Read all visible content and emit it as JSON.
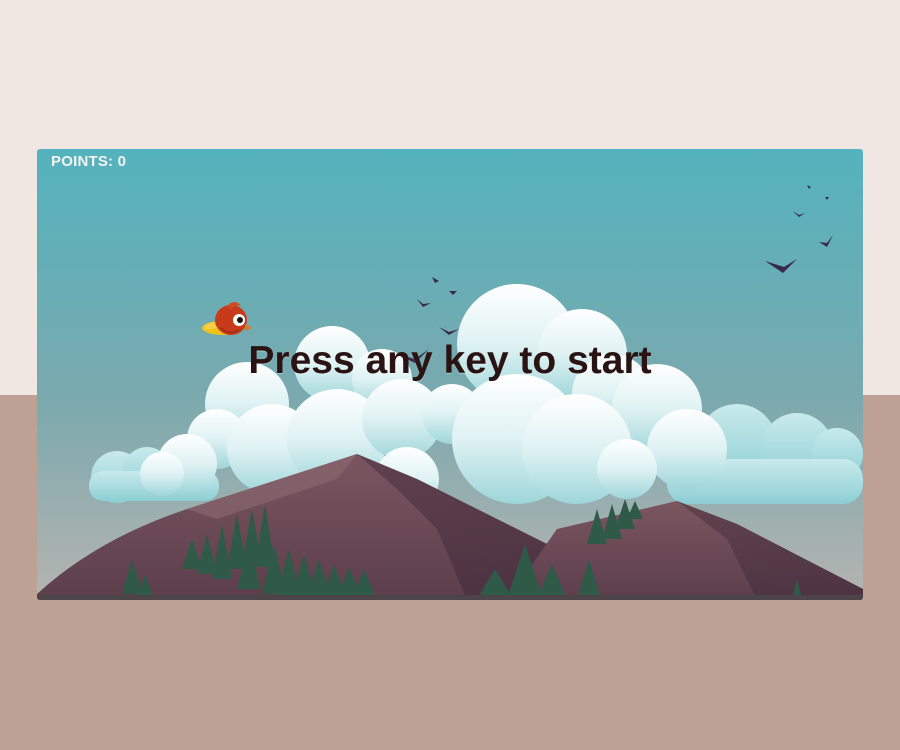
{
  "colors": {
    "page_top": "#f0e6e2",
    "page_bottom": "#bda195",
    "sky_top": "#54b3be",
    "sky_bottom": "#9aa8aa",
    "mountain": "#6d4a56",
    "tree": "#2f5a48",
    "text": "#2a1313"
  },
  "hud": {
    "score_label": "POINTS: 0"
  },
  "prompt": {
    "text": "Press any key to start"
  },
  "icons": {
    "player": "red-bird-icon",
    "flock": "flying-bird-icon"
  }
}
